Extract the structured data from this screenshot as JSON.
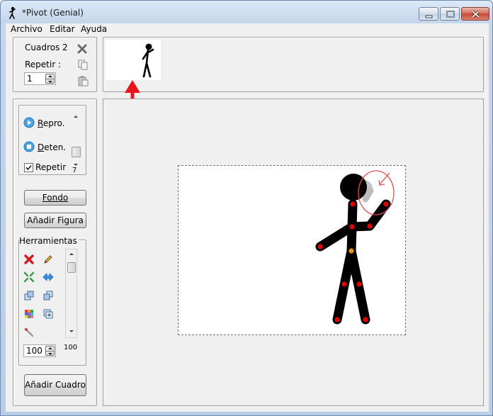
{
  "window": {
    "title": "*Pivot (Genial)"
  },
  "menu": {
    "archivo": "Archivo",
    "editar": "Editar",
    "ayuda": "Ayuda"
  },
  "frames_panel": {
    "cuadros_label": "Cuadros 2",
    "repetir_label": "Repetir :",
    "repetir_value": "1"
  },
  "playback": {
    "play_label": "Repro.",
    "stop_label": "Deten.",
    "loop_label": "Repetir",
    "loop_checked": true,
    "speed_value": "7"
  },
  "buttons": {
    "fondo": "Fondo",
    "anadir_figura": "Añadir Figura",
    "anadir_cuadro": "Añadir Cuadro"
  },
  "tools": {
    "header": "Herramientas",
    "size_value": "100",
    "scale_label": "100"
  },
  "colors": {
    "accent_red": "#e8161c",
    "handle_red": "#e00000",
    "handle_orange": "#f39000",
    "selection_ring": "#e05050"
  }
}
